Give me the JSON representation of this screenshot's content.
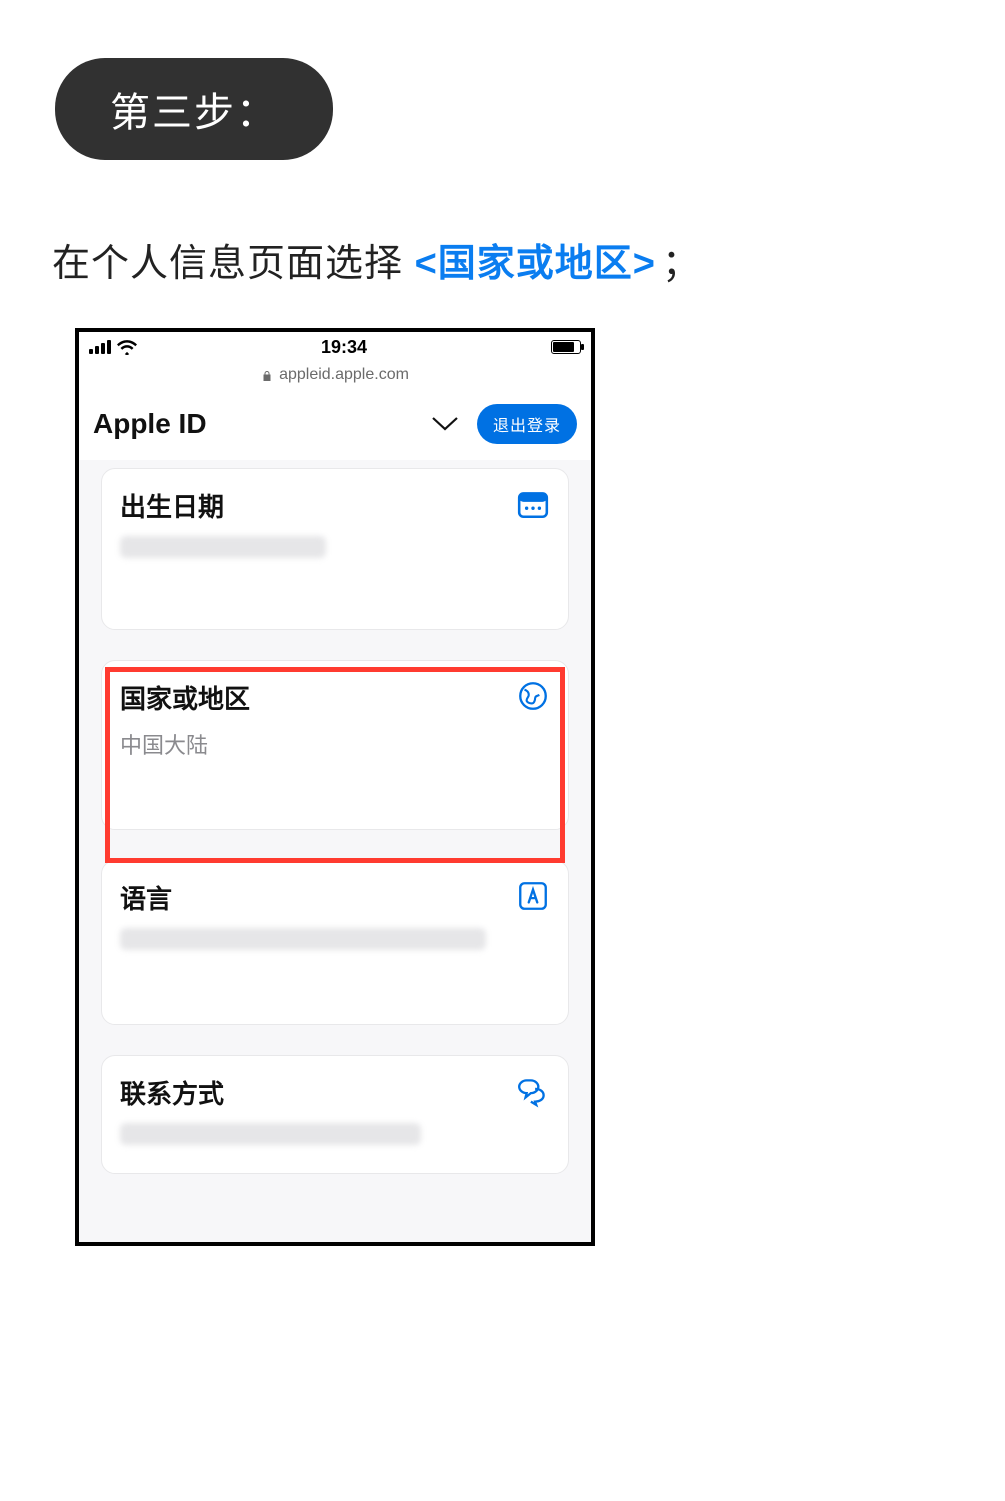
{
  "step": {
    "label": "第三步："
  },
  "instruction": {
    "prefix": "在个人信息页面选择 ",
    "highlight": "<国家或地区>",
    "suffix": "；"
  },
  "phone": {
    "status": {
      "time": "19:34"
    },
    "url": "appleid.apple.com",
    "header": {
      "title": "Apple ID",
      "signout_label": "退出登录"
    },
    "cards": {
      "birth": {
        "title": "出生日期"
      },
      "country": {
        "title": "国家或地区",
        "value": "中国大陆"
      },
      "language": {
        "title": "语言"
      },
      "contact": {
        "title": "联系方式"
      }
    }
  },
  "colors": {
    "accent": "#0071e3",
    "link": "#0a7df0",
    "highlight_border": "#ff3b30"
  }
}
